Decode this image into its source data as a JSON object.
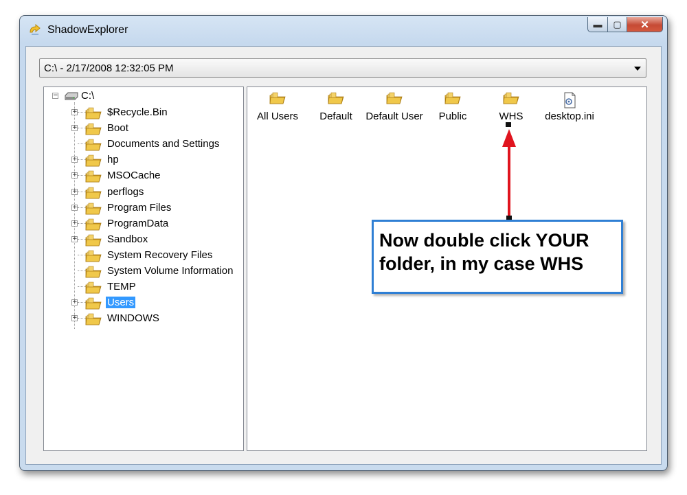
{
  "window": {
    "title": "ShadowExplorer",
    "min_glyph": "▬",
    "max_glyph": "▢",
    "close_glyph": "✕"
  },
  "snapshot": {
    "selected": "C:\\ - 2/17/2008 12:32:05 PM"
  },
  "tree": {
    "root": "C:\\",
    "items": [
      {
        "label": "$Recycle.Bin",
        "expander": "+"
      },
      {
        "label": "Boot",
        "expander": "+"
      },
      {
        "label": "Documents and Settings",
        "expander": ""
      },
      {
        "label": "hp",
        "expander": "+"
      },
      {
        "label": "MSOCache",
        "expander": "+"
      },
      {
        "label": "perflogs",
        "expander": "+"
      },
      {
        "label": "Program Files",
        "expander": "+"
      },
      {
        "label": "ProgramData",
        "expander": "+"
      },
      {
        "label": "Sandbox",
        "expander": "+"
      },
      {
        "label": "System Recovery Files",
        "expander": ""
      },
      {
        "label": "System Volume Information",
        "expander": ""
      },
      {
        "label": "TEMP",
        "expander": ""
      },
      {
        "label": "Users",
        "expander": "+",
        "selected": true
      },
      {
        "label": "WINDOWS",
        "expander": "+"
      }
    ]
  },
  "list": {
    "items": [
      {
        "label": "All Users",
        "icon": "folder-icon"
      },
      {
        "label": "Default",
        "icon": "folder-icon"
      },
      {
        "label": "Default User",
        "icon": "folder-icon"
      },
      {
        "label": "Public",
        "icon": "folder-icon"
      },
      {
        "label": "WHS",
        "icon": "folder-icon"
      },
      {
        "label": "desktop.ini",
        "icon": "settings-file-icon"
      }
    ]
  },
  "callout": {
    "text": "Now double click YOUR folder, in my case WHS"
  },
  "colors": {
    "selection": "#3399ff",
    "arrow": "#e0141e",
    "callout_border": "#2f7fd4"
  }
}
